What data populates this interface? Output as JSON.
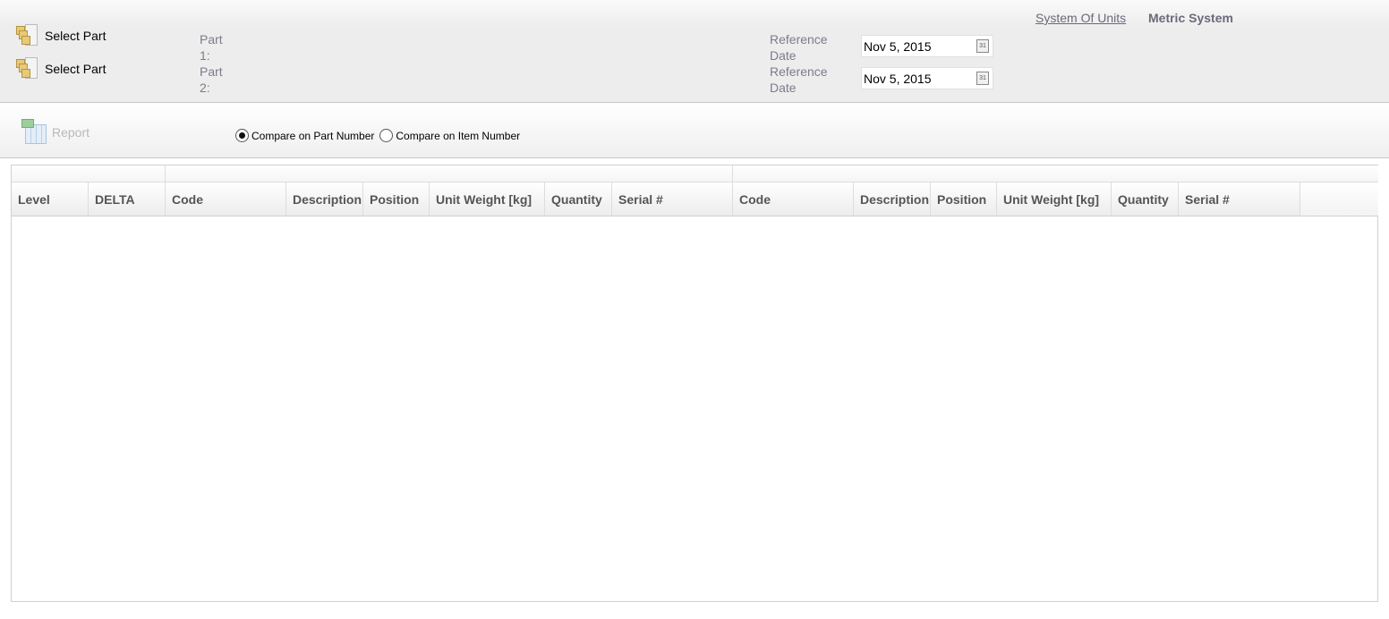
{
  "header": {
    "select_part_1": "Select Part",
    "select_part_2": "Select Part",
    "part1_label": "Part 1:",
    "part2_label": "Part 2:",
    "ref_date_label_1": "Reference Date",
    "ref_date_label_2": "Reference Date",
    "ref_date_1": "Nov 5, 2015",
    "ref_date_2": "Nov 5, 2015",
    "calendar_day": "31",
    "system_of_units_link": "System Of Units",
    "system_of_units_value": "Metric System"
  },
  "toolbar": {
    "report_label": "Report",
    "compare_part": "Compare on Part Number",
    "compare_item": "Compare on Item Number",
    "selected": "part"
  },
  "table": {
    "columns_left": [
      "Level",
      "DELTA",
      "Code",
      "Description",
      "Position",
      "Unit Weight [kg]",
      "Quantity",
      "Serial #"
    ],
    "columns_right": [
      "Code",
      "Description",
      "Position",
      "Unit Weight [kg]",
      "Quantity",
      "Serial #"
    ],
    "rows": []
  }
}
